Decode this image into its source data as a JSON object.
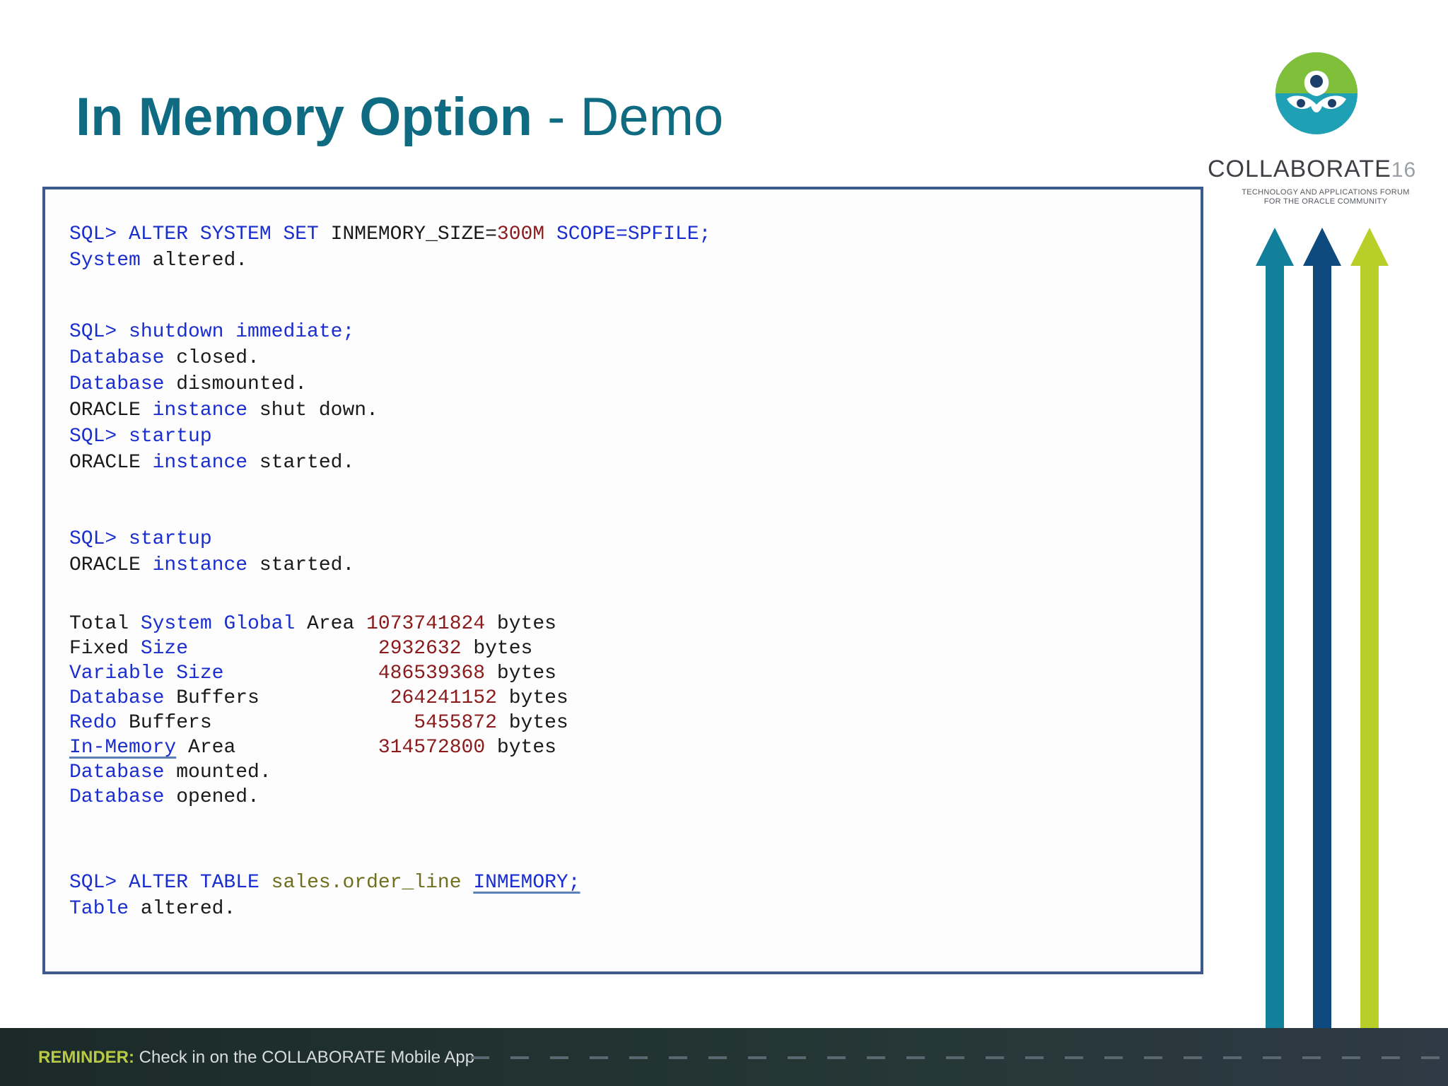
{
  "title": {
    "bold": "In Memory Option",
    "rest": " - Demo"
  },
  "logo": {
    "word": "COLLABORATE",
    "number": "16",
    "tagline_1": "Technology and Applications Forum",
    "tagline_2": "for the Oracle Community"
  },
  "code": {
    "b1": {
      "l1_prompt": "SQL> ALTER SYSTEM SET ",
      "l1_param": "INMEMORY_SIZE=",
      "l1_value": "300M",
      "l1_rest": " SCOPE=SPFILE;",
      "l2_kw": "System",
      "l2_rest": " altered."
    },
    "b2": {
      "l1": "SQL> shutdown immediate;",
      "l2_kw": "Database",
      "l2_rest": " closed.",
      "l3_kw": "Database",
      "l3_rest": " dismounted.",
      "l4_a": "ORACLE ",
      "l4_kw": "instance",
      "l4_rest": " shut down.",
      "l5": "SQL> startup",
      "l6_a": "ORACLE ",
      "l6_kw": "instance",
      "l6_rest": " started."
    },
    "b3": {
      "l1": "SQL> startup",
      "l2_a": "ORACLE ",
      "l2_kw": "instance",
      "l2_rest": " started."
    },
    "sga": [
      {
        "pre": "Total ",
        "kw": "System Global",
        "post": " Area ",
        "value": "1073741824",
        "unit": " bytes"
      },
      {
        "pre": "Fixed ",
        "kw": "Size",
        "post": "                ",
        "value": "2932632",
        "unit": " bytes"
      },
      {
        "pre": "",
        "kw": "Variable Size",
        "post": "             ",
        "value": "486539368",
        "unit": " bytes"
      },
      {
        "pre": "",
        "kw": "Database",
        "post": " Buffers           ",
        "value": "264241152",
        "unit": " bytes"
      },
      {
        "pre": "",
        "kw": "Redo",
        "post": " Buffers                 ",
        "value": "5455872",
        "unit": " bytes"
      },
      {
        "pre": "",
        "kw": "In-Memory",
        "post": " Area            ",
        "value": "314572800",
        "unit": " bytes"
      }
    ],
    "b4_end": {
      "l1_kw": "Database",
      "l1_rest": " mounted.",
      "l2_kw": "Database",
      "l2_rest": " opened."
    },
    "b5": {
      "l1_prompt": "SQL> ALTER TABLE ",
      "l1_obj": "sales.order_line",
      "l1_sp": " ",
      "l1_kw": "INMEMORY;",
      "l2_kw": "Table",
      "l2_rest": " altered."
    }
  },
  "footer": {
    "label": "REMINDER:",
    "text": " Check in on the COLLABORATE Mobile App"
  },
  "colors": {
    "title": "#0f6b82",
    "arrow_teal": "#13809b",
    "arrow_navy": "#0e4a7e",
    "arrow_lime": "#b8cf2a",
    "keyword": "#1a2ecf",
    "number": "#8b1a1a"
  }
}
